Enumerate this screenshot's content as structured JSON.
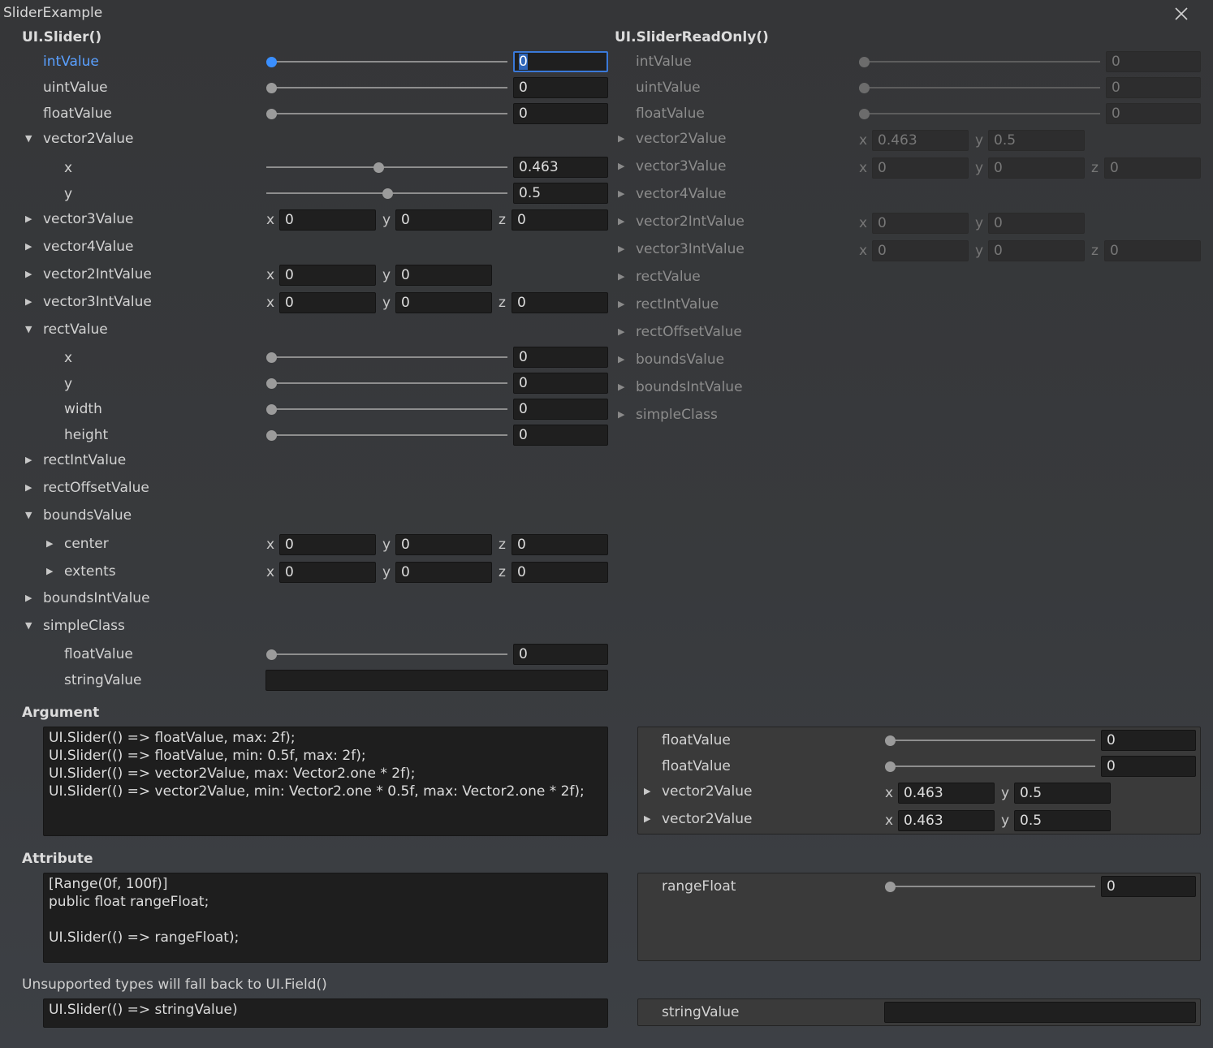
{
  "window": {
    "title": "SliderExample"
  },
  "left": {
    "header": "UI.Slider()",
    "intValue": {
      "label": "intValue",
      "value": "0",
      "level": 0
    },
    "uintValue": {
      "label": "uintValue",
      "value": "0",
      "level": 0
    },
    "floatValue": {
      "label": "floatValue",
      "value": "0",
      "level": 0
    },
    "vector2Value": {
      "label": "vector2Value",
      "x": {
        "label": "x",
        "value": "0.463",
        "level": 0.463
      },
      "y": {
        "label": "y",
        "value": "0.5",
        "level": 0.5
      }
    },
    "vector3Value": {
      "label": "vector3Value",
      "x": "0",
      "y": "0",
      "z": "0"
    },
    "vector4Value": {
      "label": "vector4Value"
    },
    "vector2IntValue": {
      "label": "vector2IntValue",
      "x": "0",
      "y": "0"
    },
    "vector3IntValue": {
      "label": "vector3IntValue",
      "x": "0",
      "y": "0",
      "z": "0"
    },
    "rectValue": {
      "label": "rectValue",
      "x": {
        "label": "x",
        "value": "0"
      },
      "y": {
        "label": "y",
        "value": "0"
      },
      "width": {
        "label": "width",
        "value": "0"
      },
      "height": {
        "label": "height",
        "value": "0"
      }
    },
    "rectIntValue": {
      "label": "rectIntValue"
    },
    "rectOffsetValue": {
      "label": "rectOffsetValue"
    },
    "boundsValue": {
      "label": "boundsValue",
      "center": {
        "label": "center",
        "x": "0",
        "y": "0",
        "z": "0"
      },
      "extents": {
        "label": "extents",
        "x": "0",
        "y": "0",
        "z": "0"
      }
    },
    "boundsIntValue": {
      "label": "boundsIntValue"
    },
    "simpleClass": {
      "label": "simpleClass",
      "floatValue": {
        "label": "floatValue",
        "value": "0"
      },
      "stringValue": {
        "label": "stringValue",
        "value": ""
      }
    }
  },
  "axes": {
    "x": "x",
    "y": "y",
    "z": "z"
  },
  "right": {
    "header": "UI.SliderReadOnly()",
    "intValue": {
      "label": "intValue",
      "value": "0"
    },
    "uintValue": {
      "label": "uintValue",
      "value": "0"
    },
    "floatValue": {
      "label": "floatValue",
      "value": "0"
    },
    "vector2Value": {
      "label": "vector2Value",
      "x": "0.463",
      "y": "0.5"
    },
    "vector3Value": {
      "label": "vector3Value",
      "x": "0",
      "y": "0",
      "z": "0"
    },
    "vector4Value": {
      "label": "vector4Value"
    },
    "vector2IntValue": {
      "label": "vector2IntValue",
      "x": "0",
      "y": "0"
    },
    "vector3IntValue": {
      "label": "vector3IntValue",
      "x": "0",
      "y": "0",
      "z": "0"
    },
    "rectValue": {
      "label": "rectValue"
    },
    "rectIntValue": {
      "label": "rectIntValue"
    },
    "rectOffsetValue": {
      "label": "rectOffsetValue"
    },
    "boundsValue": {
      "label": "boundsValue"
    },
    "boundsIntValue": {
      "label": "boundsIntValue"
    },
    "simpleClass": {
      "label": "simpleClass"
    }
  },
  "argument": {
    "header": "Argument",
    "code": "UI.Slider(() => floatValue, max: 2f);\nUI.Slider(() => floatValue, min: 0.5f, max: 2f);\nUI.Slider(() => vector2Value, max: Vector2.one * 2f);\nUI.Slider(() => vector2Value, min: Vector2.one * 0.5f, max: Vector2.one * 2f);",
    "preview": {
      "row1": {
        "label": "floatValue",
        "value": "0"
      },
      "row2": {
        "label": "floatValue",
        "value": "0"
      },
      "row3": {
        "label": "vector2Value",
        "x": "0.463",
        "y": "0.5"
      },
      "row4": {
        "label": "vector2Value",
        "x": "0.463",
        "y": "0.5"
      }
    }
  },
  "attribute": {
    "header": "Attribute",
    "code": "[Range(0f, 100f)]\npublic float rangeFloat;\n\nUI.Slider(() => rangeFloat);",
    "preview": {
      "label": "rangeFloat",
      "value": "0"
    }
  },
  "unsupported": {
    "header": "Unsupported types will fall back to UI.Field()",
    "code": "UI.Slider(() => stringValue)",
    "preview": {
      "label": "stringValue",
      "value": ""
    }
  }
}
